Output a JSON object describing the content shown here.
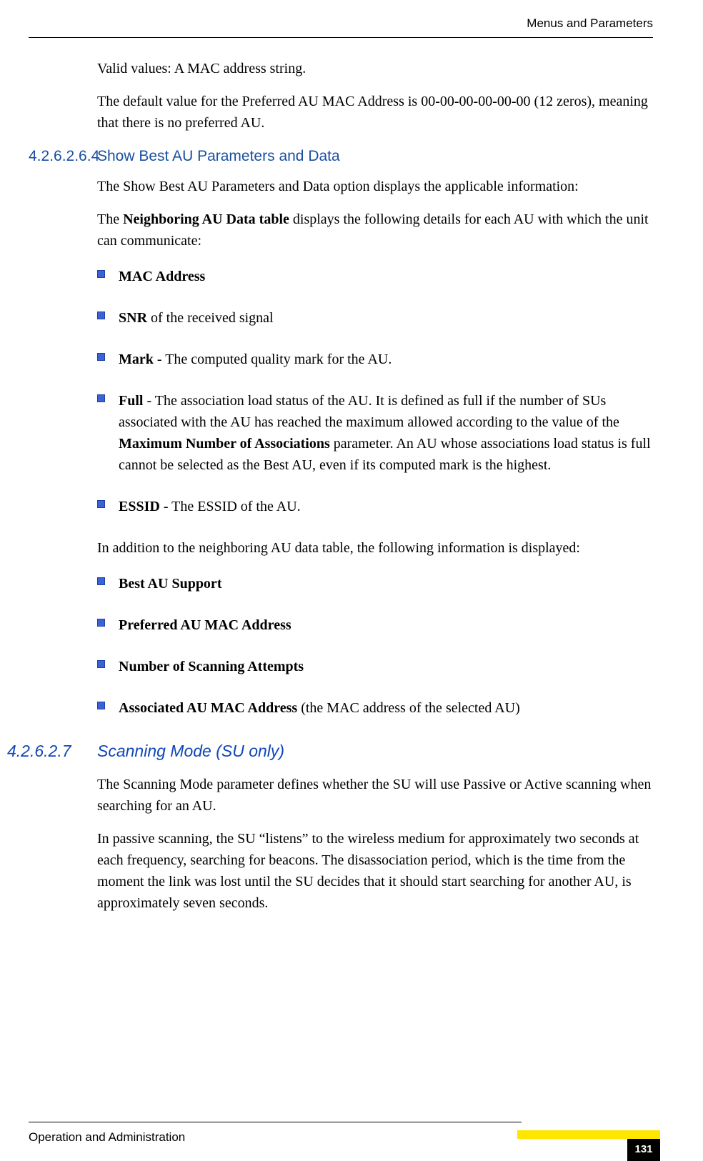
{
  "header": {
    "right": "Menus and Parameters"
  },
  "intro": {
    "p1": "Valid values: A MAC address string.",
    "p2": "The default value for the Preferred AU MAC Address is 00-00-00-00-00-00 (12 zeros), meaning that there is no preferred AU."
  },
  "section1": {
    "num": "4.2.6.2.6.4",
    "title": "Show Best AU Parameters and Data",
    "p1": "The Show Best AU Parameters and Data option displays the applicable information:",
    "p2_pre": "The ",
    "p2_bold": "Neighboring AU Data table",
    "p2_post": " displays the following details for each AU with which the unit can communicate:",
    "bullets1": [
      {
        "bold": "MAC Address",
        "rest": ""
      },
      {
        "bold": "SNR",
        "rest": " of the received signal"
      },
      {
        "bold": "Mark",
        "rest": " - The computed quality mark for the AU."
      },
      {
        "bold": "Full",
        "rest_pre": " - The association load status of the AU. It is defined as full if the number of SUs associated with the AU has reached the maximum allowed according to the value of the ",
        "mid_bold": "Maximum Number of Associations",
        "rest_post": " parameter. An AU whose associations load status is full cannot be selected as the Best AU, even if its computed mark is the highest."
      },
      {
        "bold": "ESSID",
        "rest": " - The ESSID of the AU."
      }
    ],
    "p3": "In addition to the neighboring AU data table, the following information is displayed:",
    "bullets2": [
      {
        "bold": "Best AU Support",
        "rest": ""
      },
      {
        "bold": "Preferred AU MAC Address",
        "rest": ""
      },
      {
        "bold": "Number of Scanning Attempts",
        "rest": ""
      },
      {
        "bold": "Associated AU MAC Address",
        "rest": " (the MAC address of the selected AU)"
      }
    ]
  },
  "section2": {
    "num": "4.2.6.2.7",
    "title": "Scanning Mode (SU only)",
    "p1": "The Scanning Mode parameter defines whether the SU will use Passive or Active scanning when searching for an AU.",
    "p2": "In passive scanning, the SU “listens” to the wireless medium for approximately two seconds at each frequency, searching for beacons. The disassociation period, which is the time from the moment the link was lost until the SU decides that it should start searching for another AU, is approximately seven seconds."
  },
  "footer": {
    "left": "Operation and Administration",
    "page": "131"
  }
}
